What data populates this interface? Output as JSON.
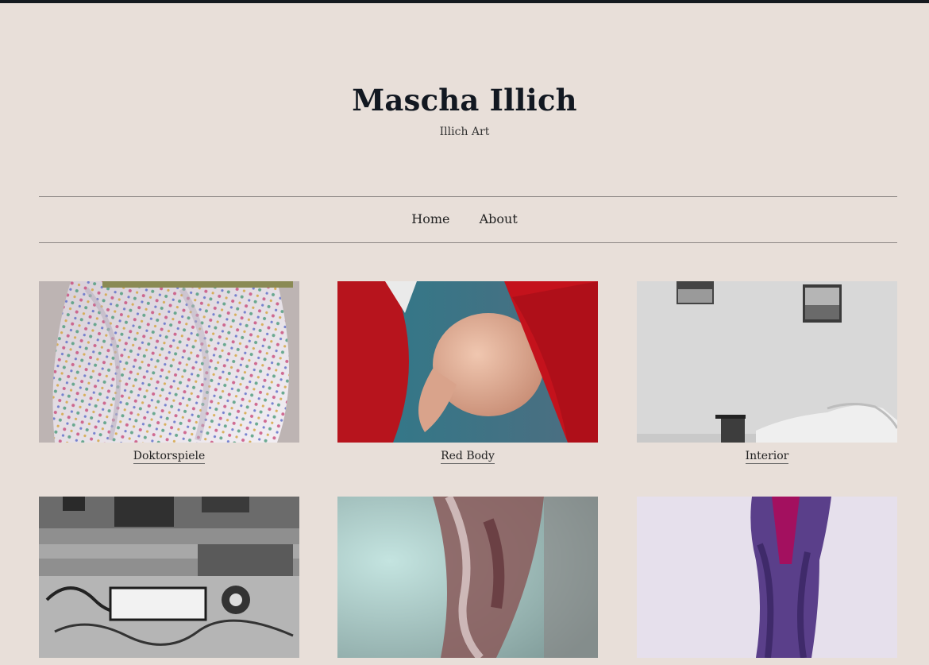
{
  "site": {
    "title": "Mascha Illich",
    "tagline": "Illich Art"
  },
  "nav": {
    "items": [
      {
        "label": "Home"
      },
      {
        "label": "About"
      }
    ]
  },
  "gallery": {
    "items": [
      {
        "caption": "Doktorspiele",
        "image": "polka-dot-fabric-photo"
      },
      {
        "caption": "Red Body",
        "image": "red-stockings-legs-photo"
      },
      {
        "caption": "Interior",
        "image": "bw-bedroom-interior-photo"
      },
      {
        "caption": "",
        "image": "graffiti-building-photo"
      },
      {
        "caption": "",
        "image": "lace-fabric-photo"
      },
      {
        "caption": "",
        "image": "purple-stockings-photo"
      }
    ]
  }
}
